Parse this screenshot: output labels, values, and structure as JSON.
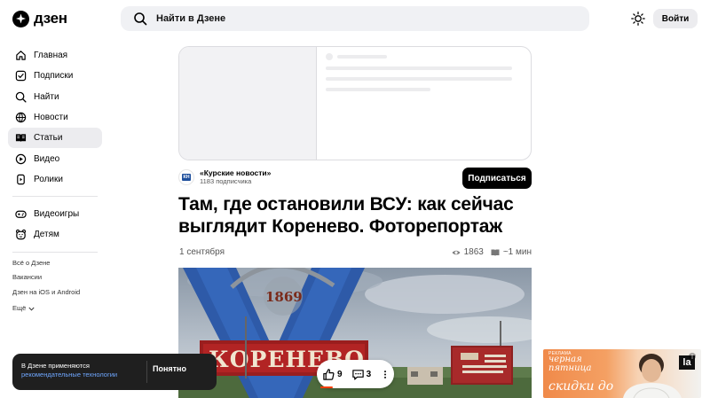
{
  "header": {
    "logo_text": "дзен",
    "search_placeholder": "Найти в Дзене",
    "login_label": "Войти"
  },
  "sidebar": {
    "items": [
      {
        "label": "Главная",
        "icon": "home-icon"
      },
      {
        "label": "Подписки",
        "icon": "subscriptions-icon"
      },
      {
        "label": "Найти",
        "icon": "search-icon"
      },
      {
        "label": "Новости",
        "icon": "news-icon"
      },
      {
        "label": "Статьи",
        "icon": "articles-icon",
        "active": true
      },
      {
        "label": "Видео",
        "icon": "video-icon"
      },
      {
        "label": "Ролики",
        "icon": "shorts-icon"
      }
    ],
    "items2": [
      {
        "label": "Видеоигры",
        "icon": "gamepad-icon"
      },
      {
        "label": "Детям",
        "icon": "kids-icon"
      }
    ],
    "footer_links": [
      "Всё о Дзене",
      "Вакансии",
      "Дзен на iOS и Android",
      "Ещё"
    ]
  },
  "article": {
    "channel_name": "«Курские новости»",
    "channel_subscribers": "1183 подписчика",
    "channel_avatar_text": "КН",
    "subscribe_label": "Подписаться",
    "title": "Там, где остановили ВСУ: как сейчас выглядит Коренево. Фоторепортаж",
    "date": "1 сентября",
    "views": "1863",
    "read_time": "~1 мин"
  },
  "photo": {
    "sign_year": "1869",
    "sign_text": "КОРЕНЕВО"
  },
  "cookie": {
    "text_line1": "В Дзене применяются",
    "link_text": "рекомендательные технологии",
    "button_label": "Понятно"
  },
  "reactions": {
    "likes": "9",
    "comments": "3"
  },
  "ad": {
    "label": "РЕКЛАМА",
    "line1a": "черная",
    "line1b": "пятница",
    "line2": "скидки до",
    "logo_text": "lа"
  }
}
